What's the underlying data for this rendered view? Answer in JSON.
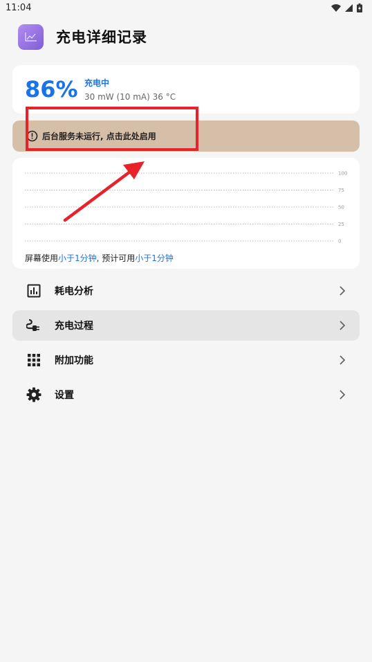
{
  "status_bar": {
    "time": "11:04",
    "icons": [
      "wifi-icon",
      "signal-icon",
      "battery-charging-icon"
    ]
  },
  "header": {
    "app_icon": "chart-line-icon",
    "title": "充电详细记录"
  },
  "battery": {
    "percent": "86%",
    "state": "充电中",
    "detail": "30 mW (10 mA) 36 °C",
    "accent_color": "#1a73e8"
  },
  "warning": {
    "icon": "alert-circle-icon",
    "text": "后台服务未运行, 点击此处启用",
    "background_color": "#d6bfa8"
  },
  "chart_data": {
    "type": "line",
    "series": [],
    "y_ticks": [
      "100",
      "75",
      "50",
      "25",
      "0"
    ],
    "ylim": [
      0,
      100
    ],
    "grid": true
  },
  "usage": {
    "prefix": "屏幕使用",
    "screen_time": "小于1分钟",
    "middle": ", 预计可用",
    "estimated": "小于1分钟"
  },
  "menu": {
    "items": [
      {
        "icon": "bar-chart-icon",
        "label": "耗电分析"
      },
      {
        "icon": "charging-plug-icon",
        "label": "充电过程"
      },
      {
        "icon": "grid-apps-icon",
        "label": "附加功能"
      },
      {
        "icon": "gear-icon",
        "label": "设置"
      }
    ]
  },
  "annotation": {
    "color": "#e8222b"
  }
}
